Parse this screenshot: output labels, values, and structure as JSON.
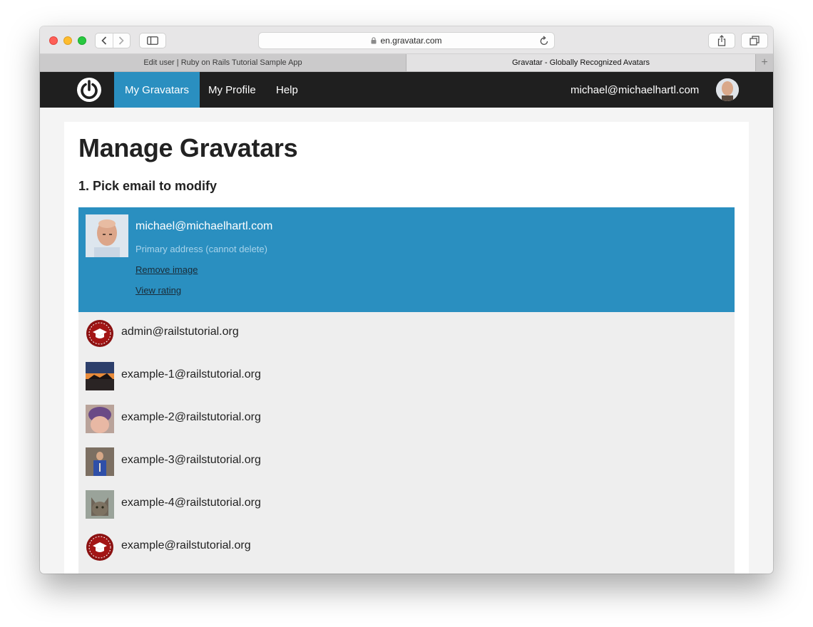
{
  "browser": {
    "url": "en.gravatar.com",
    "tabs": [
      {
        "label": "Edit user | Ruby on Rails Tutorial Sample App"
      },
      {
        "label": "Gravatar - Globally Recognized Avatars"
      }
    ],
    "new_tab_label": "+"
  },
  "nav": {
    "items": [
      {
        "label": "My Gravatars"
      },
      {
        "label": "My Profile"
      },
      {
        "label": "Help"
      }
    ],
    "user_email": "michael@michaelhartl.com"
  },
  "page": {
    "title": "Manage Gravatars",
    "section_title": "1. Pick email to modify"
  },
  "selected_email": {
    "address": "michael@michaelhartl.com",
    "note": "Primary address (cannot delete)",
    "remove_label": "Remove image",
    "rating_label": "View rating"
  },
  "emails": [
    {
      "address": "admin@railstutorial.org",
      "avatar": "rails-badge-icon"
    },
    {
      "address": "example-1@railstutorial.org",
      "avatar": "sunset-photo"
    },
    {
      "address": "example-2@railstutorial.org",
      "avatar": "child-photo"
    },
    {
      "address": "example-3@railstutorial.org",
      "avatar": "person-photo"
    },
    {
      "address": "example-4@railstutorial.org",
      "avatar": "cat-photo"
    },
    {
      "address": "example@railstutorial.org",
      "avatar": "rails-badge-icon"
    }
  ],
  "colors": {
    "accent": "#2a8fc0",
    "nav_background": "#1f1f1f",
    "list_background": "#eeeeee",
    "badge": "#8b1111"
  }
}
